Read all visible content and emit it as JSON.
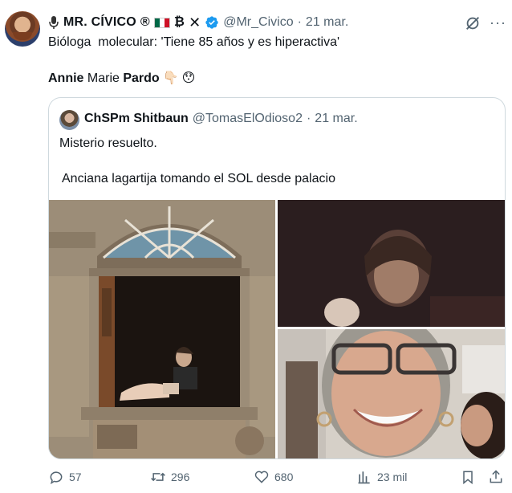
{
  "tweet": {
    "display_name": "MR. CÍVICO",
    "badge_chars": "®",
    "bitcoin_char": "₿",
    "x_char": "✕",
    "handle": "@Mr_Civico",
    "separator": "·",
    "date": "21 mar.",
    "text_line1": "Bióloga  molecular: 'Tiene 85 años y es hiperactiva'",
    "line2_bold1": "Annie",
    "line2_regular": " Marie ",
    "line2_bold2": "Pardo",
    "emoji1": "👇🏻",
    "emoji2": "😯",
    "more_label": "···"
  },
  "quote": {
    "display_name": "ChSPm Shitbaun",
    "handle": "@TomasElOdioso2",
    "separator": "·",
    "date": "21 mar.",
    "text1": "Misterio resuelto.",
    "text2": "Anciana lagartija tomando el SOL desde palacio"
  },
  "actions": {
    "replies": "57",
    "retweets": "296",
    "likes": "680",
    "views": "23 mil"
  },
  "colors": {
    "text": "#0f1419",
    "secondary": "#536471",
    "verified": "#1d9bf0",
    "border": "#cfd9de"
  },
  "icons": [
    "mic-icon",
    "flag-icon",
    "x-logo-icon",
    "verified-icon",
    "grok-icon",
    "more-icon",
    "reply-icon",
    "retweet-icon",
    "like-icon",
    "views-icon",
    "share-icon"
  ]
}
